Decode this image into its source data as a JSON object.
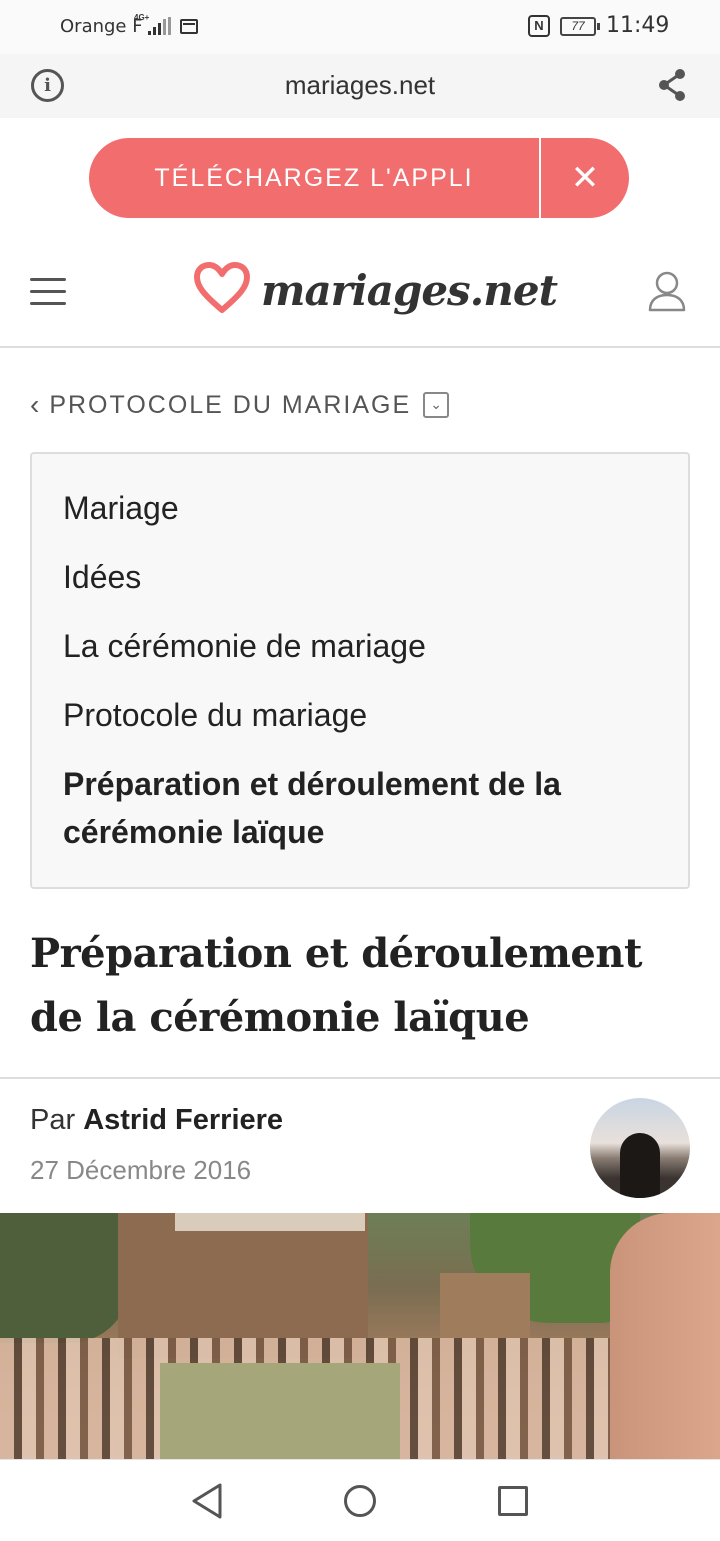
{
  "status_bar": {
    "carrier": "Orange F",
    "network": "4G+",
    "battery": "77",
    "time": "11:49"
  },
  "browser": {
    "url": "mariages.net"
  },
  "app_banner": {
    "label": "TÉLÉCHARGEZ L'APPLI",
    "close_glyph": "✕"
  },
  "header": {
    "logo_text": "mariages.net"
  },
  "breadcrumb": {
    "label": "PROTOCOLE DU MARIAGE"
  },
  "nav": {
    "items": [
      "Mariage",
      "Idées",
      "La cérémonie de mariage",
      "Protocole du mariage",
      "Préparation et déroulement de la cérémonie laïque"
    ]
  },
  "article": {
    "title": "Préparation et déroulement de la cérémonie laïque",
    "by_prefix": "Par",
    "author": "Astrid Ferriere",
    "date": "27 Décembre 2016"
  },
  "colors": {
    "accent": "#f26e6e",
    "text": "#222222",
    "muted": "#888888"
  },
  "icons": {
    "info": "info-icon",
    "share": "share-icon",
    "close": "close-icon",
    "menu": "hamburger-menu-icon",
    "logo": "heart-logo-icon",
    "user": "user-account-icon",
    "back": "chevron-left-icon",
    "dropdown": "chevron-down-icon",
    "android_back": "android-back-icon",
    "android_home": "android-home-icon",
    "android_recent": "android-recent-apps-icon"
  }
}
